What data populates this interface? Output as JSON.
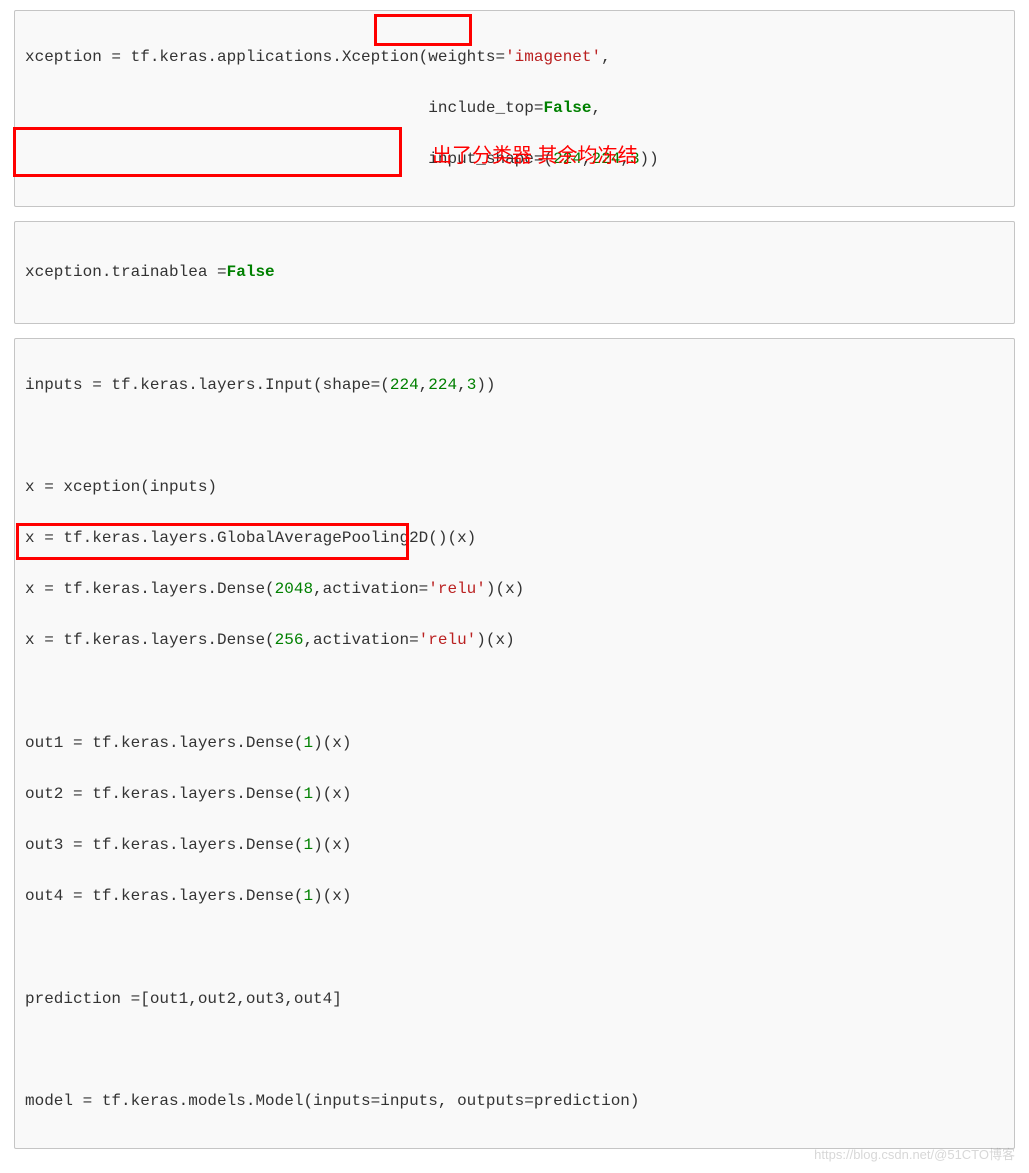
{
  "block1": {
    "line1": {
      "prefix": "xception = tf.keras.applications.Xception(weights=",
      "str1": "'imagenet'",
      "suffix": ","
    },
    "line2": {
      "indent": "                                          ",
      "key": "include_top=",
      "val": "False",
      "suffix": ","
    },
    "line3": {
      "indent": "                                          ",
      "key": "input_shape=(",
      "n1": "224",
      "c1": ",",
      "n2": "224",
      "c2": ",",
      "n3": "3",
      "suffix": "))"
    }
  },
  "block2": {
    "line1": {
      "prefix": "xception.trainablea =",
      "val": "False"
    }
  },
  "block3": {
    "l1": {
      "pre": "inputs = tf.keras.layers.Input(shape=(",
      "n1": "224",
      "c1": ",",
      "n2": "224",
      "c2": ",",
      "n3": "3",
      "suf": "))"
    },
    "l2": "",
    "l3": "x = xception(inputs)",
    "l4": "x = tf.keras.layers.GlobalAveragePooling2D()(x)",
    "l5": {
      "pre": "x = tf.keras.layers.Dense(",
      "n1": "2048",
      "mid": ",activation=",
      "s1": "'relu'",
      "suf": ")(x)"
    },
    "l6": {
      "pre": "x = tf.keras.layers.Dense(",
      "n1": "256",
      "mid": ",activation=",
      "s1": "'relu'",
      "suf": ")(x)"
    },
    "l7": "",
    "l8": {
      "pre": "out1 = tf.keras.layers.Dense(",
      "n1": "1",
      "suf": ")(x)"
    },
    "l9": {
      "pre": "out2 = tf.keras.layers.Dense(",
      "n1": "1",
      "suf": ")(x)"
    },
    "l10": {
      "pre": "out3 = tf.keras.layers.Dense(",
      "n1": "1",
      "suf": ")(x)"
    },
    "l11": {
      "pre": "out4 = tf.keras.layers.Dense(",
      "n1": "1",
      "suf": ")(x)"
    },
    "l12": "",
    "l13": "prediction =[out1,out2,out3,out4]",
    "l14": "",
    "l15": "model = tf.keras.models.Model(inputs=inputs, outputs=prediction)"
  },
  "annotation": "出了分类器 其余均冻结",
  "watermark": "https://blog.csdn.net/@51CTO博客",
  "chart_data": {
    "type": "table",
    "description": "Python Keras code snippet with red box highlights",
    "code_cells": [
      "xception = tf.keras.applications.Xception(weights='imagenet', include_top=False, input_shape=(224,224,3))",
      "xception.trainablea =False",
      "inputs = tf.keras.layers.Input(shape=(224,224,3))",
      "x = xception(inputs)",
      "x = tf.keras.layers.GlobalAveragePooling2D()(x)",
      "x = tf.keras.layers.Dense(2048,activation='relu')(x)",
      "x = tf.keras.layers.Dense(256,activation='relu')(x)",
      "out1 = tf.keras.layers.Dense(1)(x)",
      "out2 = tf.keras.layers.Dense(1)(x)",
      "out3 = tf.keras.layers.Dense(1)(x)",
      "out4 = tf.keras.layers.Dense(1)(x)",
      "prediction =[out1,out2,out3,out4]",
      "model = tf.keras.models.Model(inputs=inputs, outputs=prediction)"
    ],
    "highlights": [
      "Xception( — boxed in red",
      "xception.trainablea =False — boxed in red, annotated '出了分类器 其余均冻结'",
      "prediction =[out1,out2,out3,out4] — boxed in red"
    ]
  }
}
